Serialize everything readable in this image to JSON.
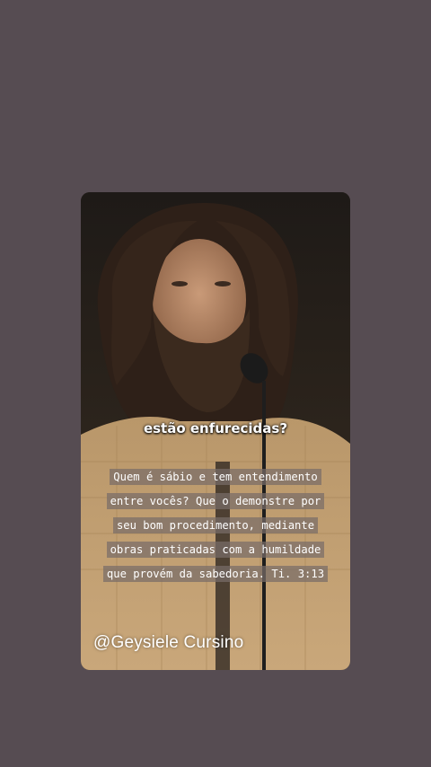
{
  "subtitle": "estão enfurecidas?",
  "verse": "Quem é sábio e tem entendimento entre vocês? Que o demonstre por seu bom procedimento, mediante obras praticadas com a humildade que provém da sabedoria. Ti. 3:13",
  "watermark": "@Geysiele Cursino",
  "colors": {
    "page_background": "#564c52",
    "verse_highlight": "#786c68"
  }
}
